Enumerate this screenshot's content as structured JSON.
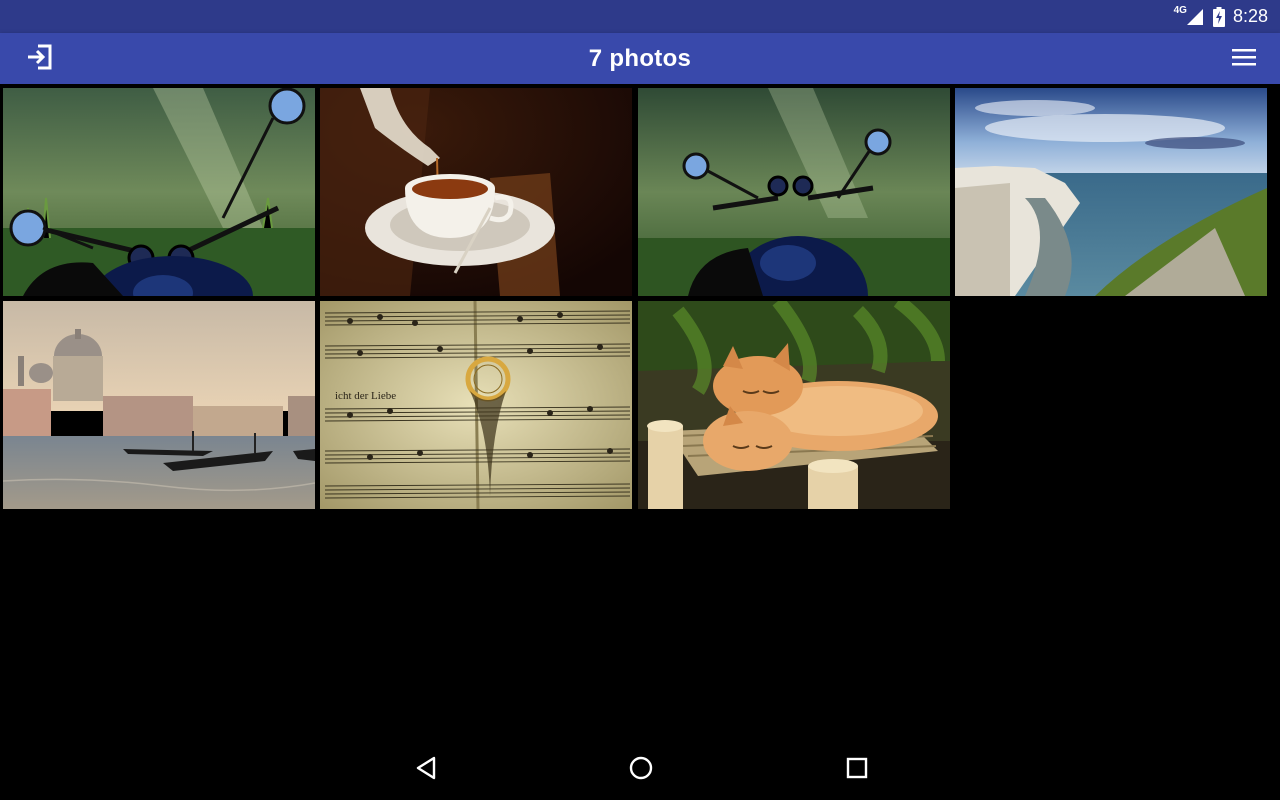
{
  "status_bar": {
    "network": "4G",
    "time": "8:28"
  },
  "app_bar": {
    "title": "7 photos",
    "colors": {
      "primary": "#3949ab",
      "status": "#2e3a8a"
    }
  },
  "photos": [
    {
      "subject": "motorcycle"
    },
    {
      "subject": "teacup"
    },
    {
      "subject": "motorcycle"
    },
    {
      "subject": "cliffs-seascape"
    },
    {
      "subject": "venice-gondolas"
    },
    {
      "subject": "sheet-music-ring"
    },
    {
      "subject": "sleeping-kittens"
    }
  ],
  "nav_bar": {
    "icons": [
      "back-icon",
      "home-icon",
      "recents-icon"
    ]
  }
}
